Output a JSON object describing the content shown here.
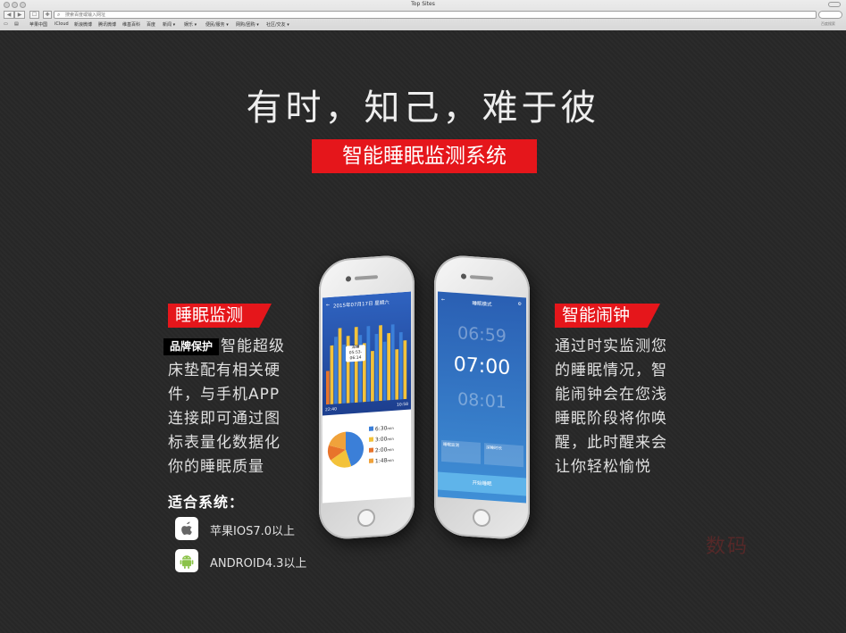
{
  "window": {
    "title": "Top Sites"
  },
  "toolbar": {
    "back": "◀",
    "forward": "▶",
    "share": "✚",
    "address_placeholder": "搜索百度或输入网址",
    "search_placeholder": "百度搜索"
  },
  "bookmarks": [
    "苹果中国",
    "iCloud",
    "新浪微博",
    "腾讯微博",
    "维基百科",
    "百度",
    "新闻 ▾",
    "娱乐 ▾",
    "便民/服务 ▾",
    "网购/团购 ▾",
    "社区/交友 ▾"
  ],
  "hero": {
    "headline": "有时，知己，难于彼",
    "subtitle": "智能睡眠监测系统"
  },
  "left": {
    "label": "睡眠监测",
    "brand_badge": "品牌保护",
    "lines": [
      "智能超级",
      "床垫配有相关硬",
      "件，与手机APP",
      "连接即可通过图",
      "标表量化数据化",
      "你的睡眠质量"
    ],
    "systems_title": "适合系统：",
    "systems": [
      {
        "icon": "apple-icon",
        "text": "苹果IOS7.0以上"
      },
      {
        "icon": "android-icon",
        "text": "ANDROID4.3以上"
      }
    ]
  },
  "right": {
    "label": "智能闹钟",
    "lines": [
      "通过时实监测您",
      "的睡眠情况，智",
      "能闹钟会在您浅",
      "睡眠阶段将你唤",
      "醒，此时醒来会",
      "让你轻松愉悦"
    ]
  },
  "phone_left": {
    "date": "2015年07月17日 星期六",
    "bubble": [
      "深睡",
      "05:53-06:14"
    ],
    "time_start": "22:40",
    "time_end": "10:58",
    "legend": [
      "6:30",
      "3:00",
      "2:00",
      "1:48"
    ],
    "legend_unit": "min",
    "legend_colors": [
      "#3b7fd8",
      "#f3c23a",
      "#e8742b",
      "#f0a23b"
    ],
    "bars": [
      4,
      7,
      8,
      9,
      7,
      8,
      6,
      9,
      8,
      7,
      9,
      6,
      8,
      9,
      7,
      8,
      9,
      6,
      8,
      7
    ],
    "bar_colors": [
      "#e8742b",
      "#f3c23a",
      "#3b7fd8",
      "#f3c23a",
      "#3b7fd8",
      "#f3c23a",
      "#3b7fd8",
      "#f3c23a",
      "#3b7fd8",
      "#f3c23a",
      "#3b7fd8",
      "#f3c23a",
      "#3b7fd8",
      "#f3c23a",
      "#3b7fd8",
      "#f3c23a",
      "#3b7fd8",
      "#f3c23a",
      "#3b7fd8",
      "#f3c23a"
    ],
    "pie": [
      45,
      21,
      14,
      20
    ]
  },
  "phone_right": {
    "title": "睡眠模式",
    "times": [
      "06:59",
      "07:00",
      "08:01"
    ],
    "card1": "睡眠监测",
    "card2": "深睡时长",
    "button": "开始睡眠"
  },
  "watermark": "数码"
}
